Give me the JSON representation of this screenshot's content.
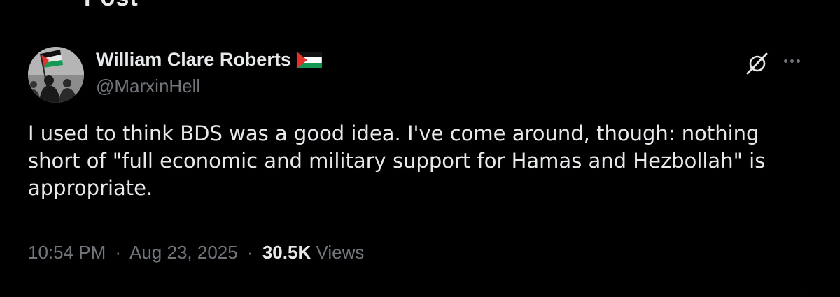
{
  "header": {
    "title_fragment": "Post"
  },
  "author": {
    "display_name": "William Clare Roberts",
    "handle": "@MarxinHell",
    "name_flag_icon": "palestine-flag-icon",
    "avatar_icon": "palestine-flag-silhouette-avatar"
  },
  "actions": {
    "grok_icon": "grok-icon",
    "more_icon": "more-dots-icon"
  },
  "tweet": {
    "lines": [
      "I used to think BDS was a good idea. I've come around, though: nothing",
      "short of \"full economic and military support for Hamas and Hezbollah\" is",
      "appropriate."
    ]
  },
  "meta": {
    "time": "10:54 PM",
    "separator": "·",
    "date": "Aug 23, 2025",
    "views_count": "30.5K",
    "views_label": "Views"
  },
  "colors": {
    "background": "#000000",
    "primary_text": "#e7e9ea",
    "secondary_text": "#71767b",
    "divider": "#2f3336",
    "flag_red": "#e4312b",
    "flag_green": "#149954"
  }
}
